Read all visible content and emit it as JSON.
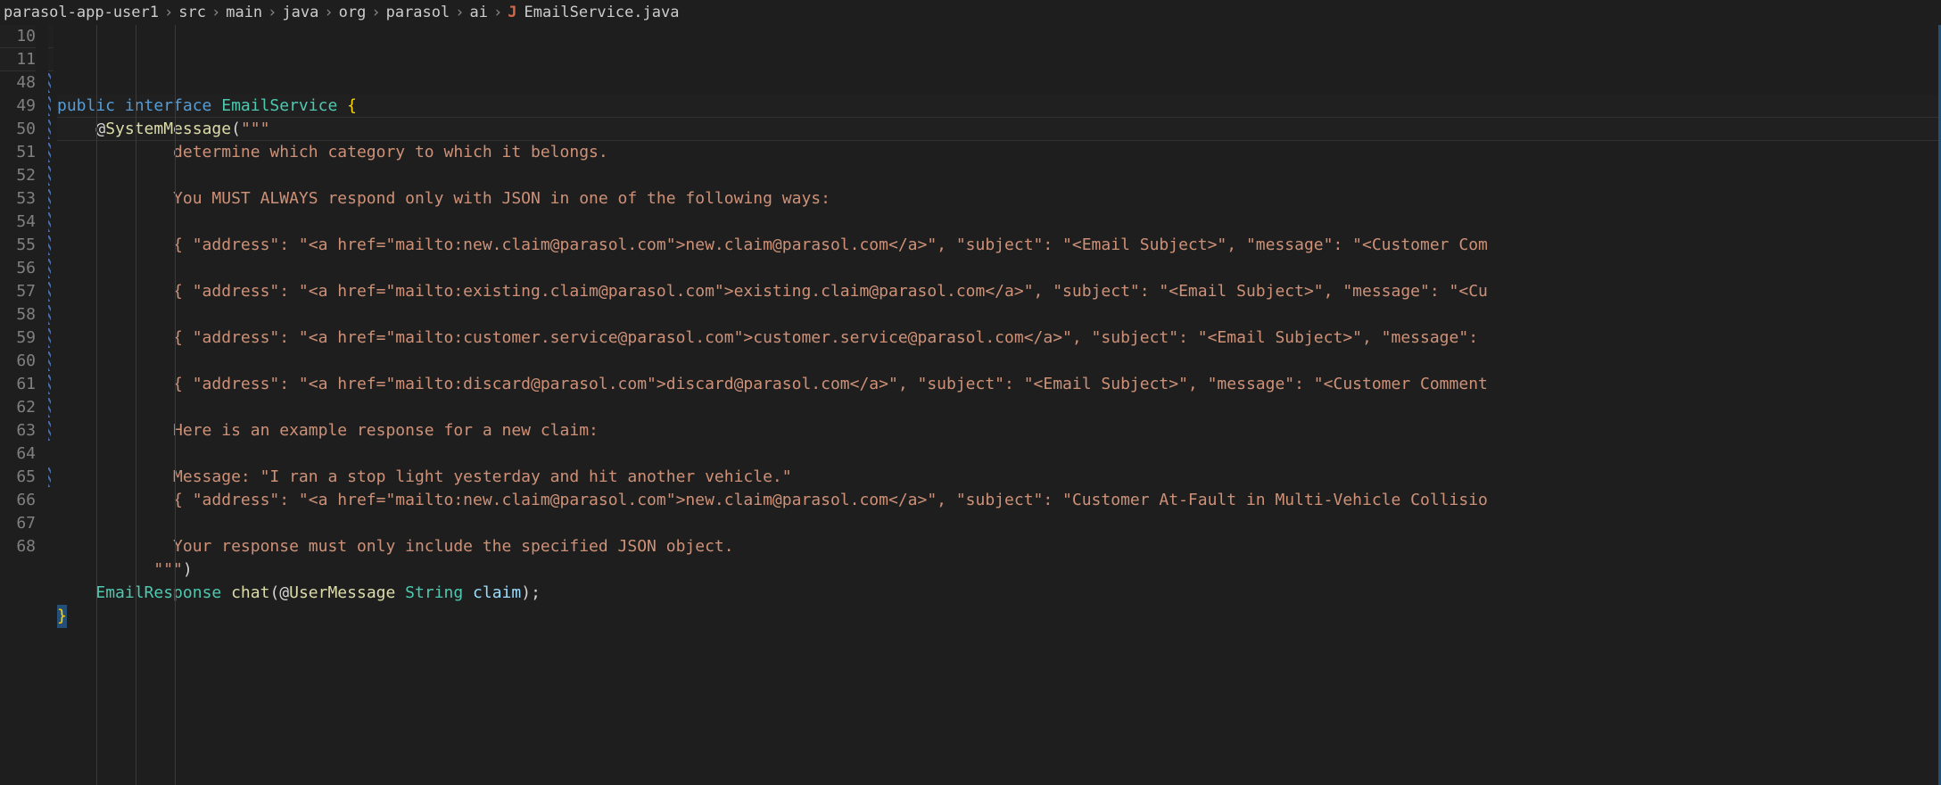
{
  "breadcrumb": {
    "segments": [
      "parasol-app-user1",
      "src",
      "main",
      "java",
      "org",
      "parasol",
      "ai"
    ],
    "file_icon": "J",
    "file_name": "EmailService.java",
    "separator": "›"
  },
  "sticky_lines": [
    {
      "num": 10,
      "tokens": [
        {
          "t": "public ",
          "c": "kw"
        },
        {
          "t": "interface ",
          "c": "kw"
        },
        {
          "t": "EmailService ",
          "c": "type"
        },
        {
          "t": "{",
          "c": "brc"
        }
      ]
    },
    {
      "num": 11,
      "indent": 1,
      "tokens": [
        {
          "t": "@",
          "c": "at"
        },
        {
          "t": "SystemMessage",
          "c": "ann"
        },
        {
          "t": "(",
          "c": "pun"
        },
        {
          "t": "\"\"\"",
          "c": "str"
        }
      ]
    }
  ],
  "lines": [
    {
      "num": 48,
      "hatched": true,
      "indent": 3,
      "tokens": [
        {
          "t": "determine which category to which it belongs.",
          "c": "str"
        }
      ]
    },
    {
      "num": 49,
      "hatched": true,
      "indent": 3,
      "tokens": [
        {
          "t": "",
          "c": "str"
        }
      ]
    },
    {
      "num": 50,
      "hatched": true,
      "indent": 3,
      "tokens": [
        {
          "t": "You MUST ALWAYS respond only with JSON in one of the following ways:",
          "c": "str"
        }
      ]
    },
    {
      "num": 51,
      "hatched": true,
      "indent": 3,
      "tokens": [
        {
          "t": "",
          "c": "str"
        }
      ]
    },
    {
      "num": 52,
      "hatched": true,
      "indent": 3,
      "tokens": [
        {
          "t": "{ \"address\": \"<a href=\"mailto:new.claim@parasol.com\">new.claim@parasol.com</a>\", \"subject\": \"<Email Subject>\", \"message\": \"<Customer Com",
          "c": "str"
        }
      ]
    },
    {
      "num": 53,
      "hatched": true,
      "indent": 3,
      "tokens": [
        {
          "t": "",
          "c": "str"
        }
      ]
    },
    {
      "num": 54,
      "hatched": true,
      "indent": 3,
      "tokens": [
        {
          "t": "{ \"address\": \"<a href=\"mailto:existing.claim@parasol.com\">existing.claim@parasol.com</a>\", \"subject\": \"<Email Subject>\", \"message\": \"<Cu",
          "c": "str"
        }
      ]
    },
    {
      "num": 55,
      "hatched": true,
      "indent": 3,
      "tokens": [
        {
          "t": "",
          "c": "str"
        }
      ]
    },
    {
      "num": 56,
      "hatched": true,
      "indent": 3,
      "tokens": [
        {
          "t": "{ \"address\": \"<a href=\"mailto:customer.service@parasol.com\">customer.service@parasol.com</a>\", \"subject\": \"<Email Subject>\", \"message\":",
          "c": "str"
        }
      ]
    },
    {
      "num": 57,
      "hatched": true,
      "indent": 3,
      "tokens": [
        {
          "t": "",
          "c": "str"
        }
      ]
    },
    {
      "num": 58,
      "hatched": true,
      "indent": 3,
      "tokens": [
        {
          "t": "{ \"address\": \"<a href=\"mailto:discard@parasol.com\">discard@parasol.com</a>\", \"subject\": \"<Email Subject>\", \"message\": \"<Customer Comment",
          "c": "str"
        }
      ]
    },
    {
      "num": 59,
      "hatched": true,
      "indent": 3,
      "tokens": [
        {
          "t": "",
          "c": "str"
        }
      ]
    },
    {
      "num": 60,
      "hatched": true,
      "indent": 3,
      "tokens": [
        {
          "t": "Here is an example response for a new claim:",
          "c": "str"
        }
      ]
    },
    {
      "num": 61,
      "hatched": true,
      "indent": 3,
      "tokens": [
        {
          "t": "",
          "c": "str"
        }
      ]
    },
    {
      "num": 62,
      "hatched": true,
      "indent": 3,
      "tokens": [
        {
          "t": "Message: \"I ran a stop light yesterday and hit another vehicle.\"",
          "c": "str"
        }
      ]
    },
    {
      "num": 63,
      "hatched": true,
      "indent": 3,
      "tokens": [
        {
          "t": "{ \"address\": \"<a href=\"mailto:new.claim@parasol.com\">new.claim@parasol.com</a>\", \"subject\": \"Customer At-Fault in Multi-Vehicle Collisio",
          "c": "str"
        }
      ]
    },
    {
      "num": 64,
      "hatched": false,
      "indent": 3,
      "tokens": [
        {
          "t": "",
          "c": "str"
        }
      ]
    },
    {
      "num": 65,
      "hatched": true,
      "indent": 3,
      "tokens": [
        {
          "t": "Your response must only include the specified JSON object.",
          "c": "str"
        }
      ]
    },
    {
      "num": 66,
      "hatched": false,
      "indent": 2,
      "tokens": [
        {
          "t": "  \"\"\"",
          "c": "str"
        },
        {
          "t": ")",
          "c": "pun"
        }
      ]
    },
    {
      "num": 67,
      "hatched": false,
      "indent": 1,
      "tokens": [
        {
          "t": "EmailResponse ",
          "c": "type"
        },
        {
          "t": "chat",
          "c": "fn"
        },
        {
          "t": "(",
          "c": "pun"
        },
        {
          "t": "@",
          "c": "at"
        },
        {
          "t": "UserMessage",
          "c": "ann"
        },
        {
          "t": " String ",
          "c": "type"
        },
        {
          "t": "claim",
          "c": "id"
        },
        {
          "t": ");",
          "c": "pun"
        }
      ]
    },
    {
      "num": 68,
      "hatched": false,
      "indent": 0,
      "tokens": [
        {
          "t": "}",
          "c": "brc",
          "cursor": true
        }
      ]
    }
  ],
  "indent_unit": "    "
}
